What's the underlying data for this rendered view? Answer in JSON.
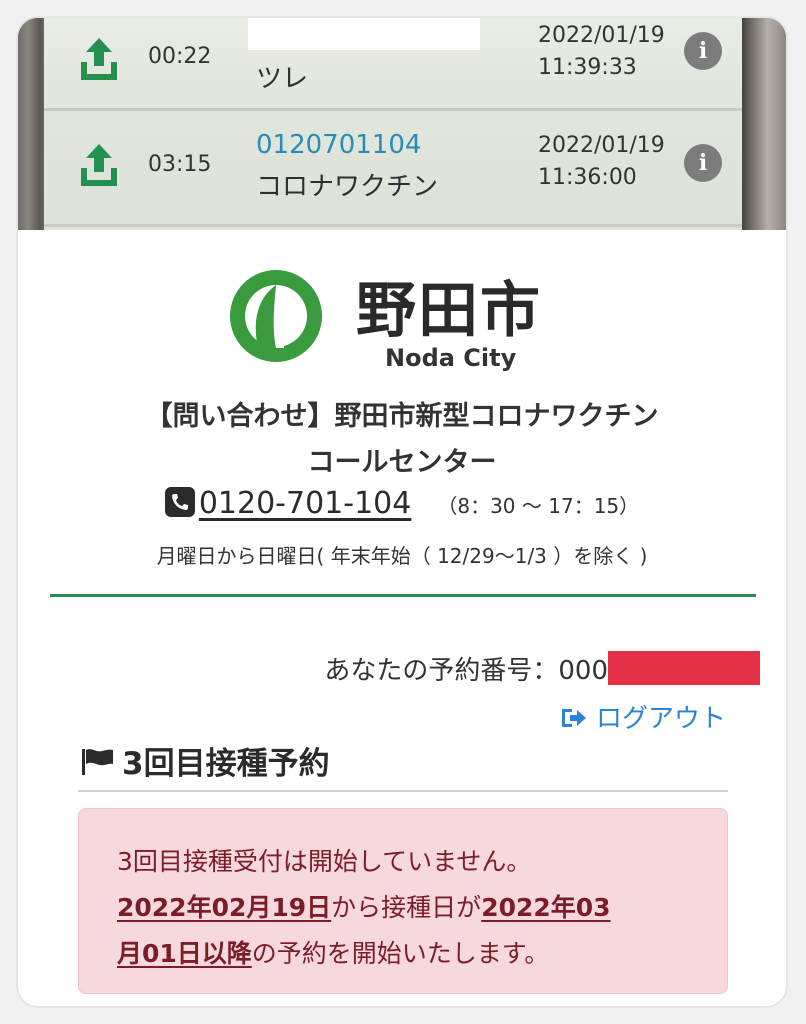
{
  "photo": {
    "row1": {
      "duration": "00:22",
      "name": "ツレ",
      "date": "2022/01/19",
      "time": "11:39:33",
      "info": "i"
    },
    "row2": {
      "duration": "03:15",
      "number": "0120701104",
      "name": "コロナワクチン",
      "date": "2022/01/19",
      "time": "11:36:00",
      "info": "i"
    }
  },
  "header": {
    "city_kanji": "野田市",
    "city_en": "Noda City",
    "contact_line1": "【問い合わせ】野田市新型コロナワクチン",
    "contact_line2": "コールセンター",
    "phone": "0120-701-104",
    "hours": "（8：30 ～ 17：15）",
    "days": "月曜日から日曜日( 年末年始（ 12/29～1/3 ）を除く )"
  },
  "reservation": {
    "number_label": "あなたの予約番号：",
    "number_visible": "000",
    "logout_label": "ログアウト",
    "section_title": "3回目接種予約"
  },
  "alert": {
    "line1": "3回目接種受付は開始していません。",
    "date_from": "2022年02月19日",
    "mid": "から接種日が",
    "date_vacc_a": "2022年03",
    "date_vacc_b": "月01日以降",
    "tail": "の予約を開始いたします。"
  },
  "colors": {
    "brand_green": "#23914d",
    "link_blue": "#2d84d6",
    "alert_bg": "#f7d9dd",
    "alert_text": "#7a1d28",
    "redaction": "#e43148"
  },
  "icons": [
    "upload-icon",
    "info-icon",
    "noda-logo",
    "phone-icon",
    "logout-icon",
    "flag-icon"
  ]
}
